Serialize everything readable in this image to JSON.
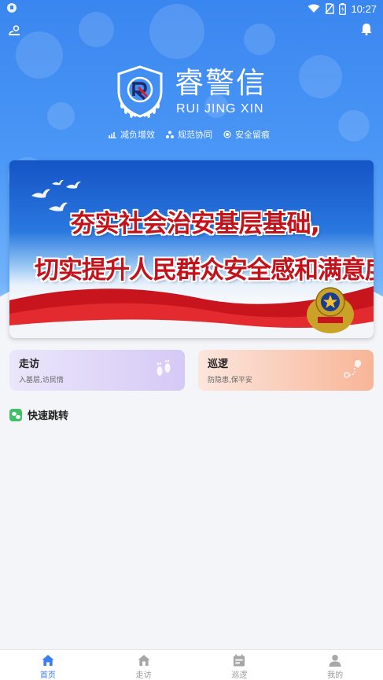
{
  "status_bar": {
    "time": "10:27"
  },
  "brand": {
    "title": "睿警信",
    "subtitle": "RUI JING XIN"
  },
  "taglines": [
    {
      "icon": "chart-icon",
      "label": "减负增效"
    },
    {
      "icon": "nodes-icon",
      "label": "规范协同"
    },
    {
      "icon": "eye-icon",
      "label": "安全留痕"
    }
  ],
  "banner": {
    "line1": "夯实社会治安基层基础,",
    "line2": "切实提升人民群众安全感和满意度"
  },
  "cards": {
    "visit": {
      "title": "走访",
      "subtitle": "入基层,访民情"
    },
    "patrol": {
      "title": "巡逻",
      "subtitle": "防隐患,保平安"
    }
  },
  "quick": {
    "label": "快速跳转"
  },
  "nav": [
    {
      "label": "首页",
      "icon": "home-icon",
      "active": true
    },
    {
      "label": "走访",
      "icon": "house-icon",
      "active": false
    },
    {
      "label": "巡逻",
      "icon": "calendar-icon",
      "active": false
    },
    {
      "label": "我的",
      "icon": "user-icon",
      "active": false
    }
  ],
  "colors": {
    "primary": "#3a86f0",
    "active": "#3a7ff0",
    "banner_text": "#c4121a",
    "green": "#3fbf66"
  }
}
